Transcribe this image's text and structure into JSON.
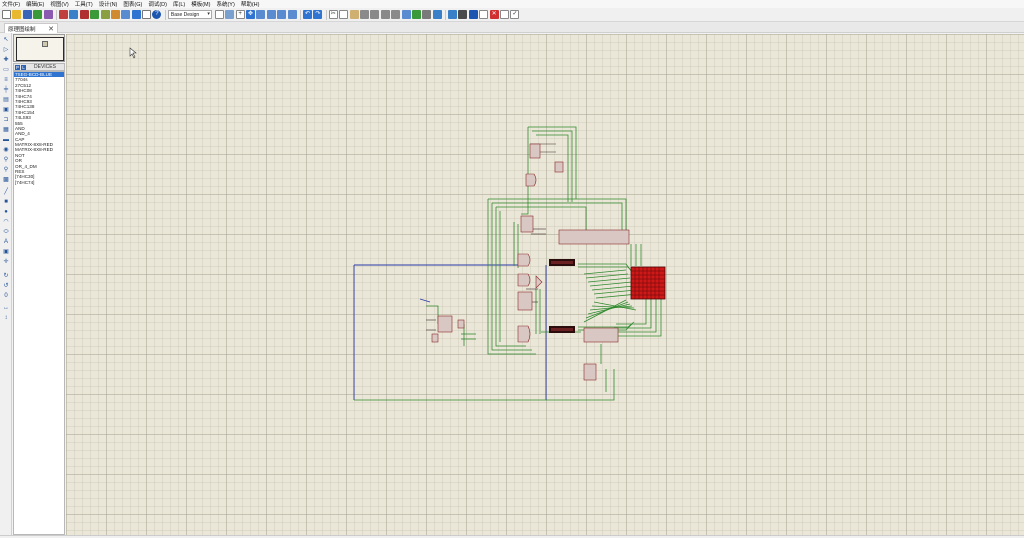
{
  "menu": [
    "文件(F)",
    "编辑(E)",
    "视图(V)",
    "工具(T)",
    "设计(N)",
    "图表(G)",
    "调试(D)",
    "库(L)",
    "模板(M)",
    "系统(Y)",
    "帮助(H)"
  ],
  "toolbar": {
    "design_combo": "Base Design"
  },
  "tab": {
    "title": "原理图绘制",
    "close": "✕"
  },
  "device_panel": {
    "pick_p": "P",
    "pick_l": "L",
    "title": "DEVICES",
    "items": [
      "7SEG-BCD-BLUE",
      "7704s",
      "27C512",
      "74HC08",
      "74HC74",
      "74HC93",
      "74HC138",
      "74HC154",
      "74LS93",
      "555",
      "AND",
      "AND_4",
      "CAP",
      "MATRIX-8X8-RED",
      "MATRIX-8X8-RED",
      "NOT",
      "OR",
      "OR_4_DM",
      "RES",
      "[74HC30]",
      "[74HC74]"
    ],
    "selected_index": 0
  },
  "colors": {
    "wire_green": "#2f8a2f",
    "wire_blue": "#2a3aa8",
    "component_fill": "#d9c7c3",
    "component_stroke": "#8b2a2a",
    "matrix_red": "#d01818",
    "display_dark": "#2a0c0c",
    "selection_blue": "#2f74d0"
  }
}
